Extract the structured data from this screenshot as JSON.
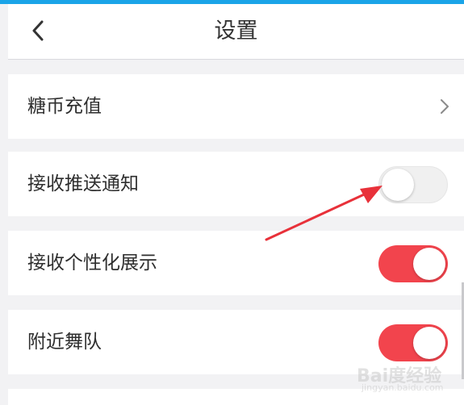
{
  "header": {
    "title": "设置",
    "back_icon": "chevron-left-icon"
  },
  "settings": [
    {
      "label": "糖币充值",
      "type": "link",
      "icon": "chevron-right-icon"
    },
    {
      "label": "接收推送通知",
      "type": "toggle",
      "on": false
    },
    {
      "label": "接收个性化展示",
      "type": "toggle",
      "on": true
    },
    {
      "label": "附近舞队",
      "type": "toggle",
      "on": true
    }
  ],
  "colors": {
    "accent_top_bar": "#1aa4e8",
    "toggle_on": "#f2444d",
    "toggle_off": "#f0f0f0",
    "annotation_arrow": "#e8313a"
  },
  "watermark": {
    "brand": "Bai度经验",
    "url": "jingyan.baidu.com"
  }
}
